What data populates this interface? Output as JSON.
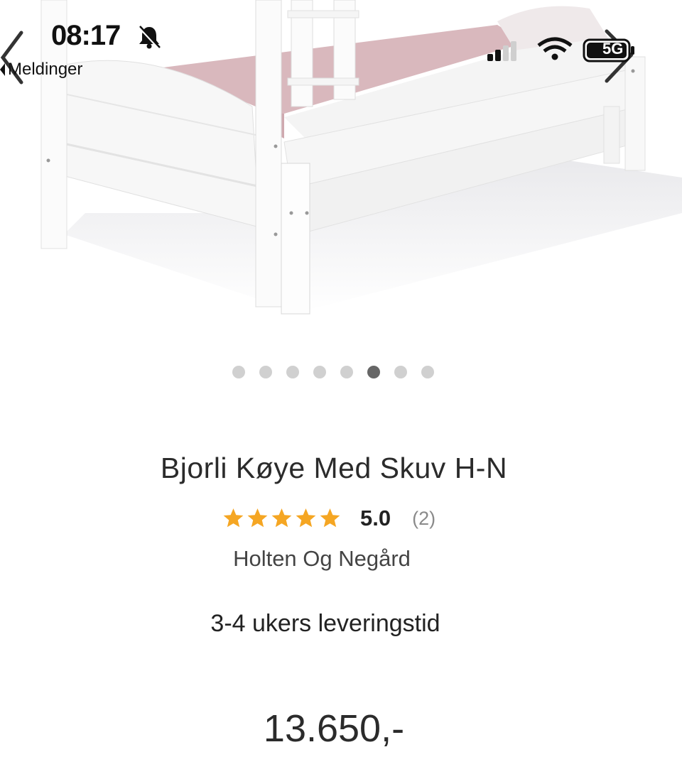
{
  "status_bar": {
    "time": "08:17",
    "back_app": "Meldinger",
    "network": "5G"
  },
  "gallery": {
    "image_count": 8,
    "active_index": 5
  },
  "product": {
    "title": "Bjorli Køye Med Skuv H-N",
    "rating_value": "5.0",
    "rating_count": "(2)",
    "stars": 5,
    "brand": "Holten Og Negård",
    "delivery": "3-4 ukers leveringstid",
    "price": "13.650,-"
  },
  "colors": {
    "star": "#f5a623",
    "dot_inactive": "#d0d0d0",
    "dot_active": "#666666",
    "mattress": "#d9b8bd"
  },
  "icons": {
    "bell": "bell-slash-icon",
    "signal": "cellular-signal-icon",
    "wifi": "wifi-icon",
    "battery": "battery-icon",
    "prev": "chevron-left-icon",
    "next": "chevron-right-icon"
  }
}
